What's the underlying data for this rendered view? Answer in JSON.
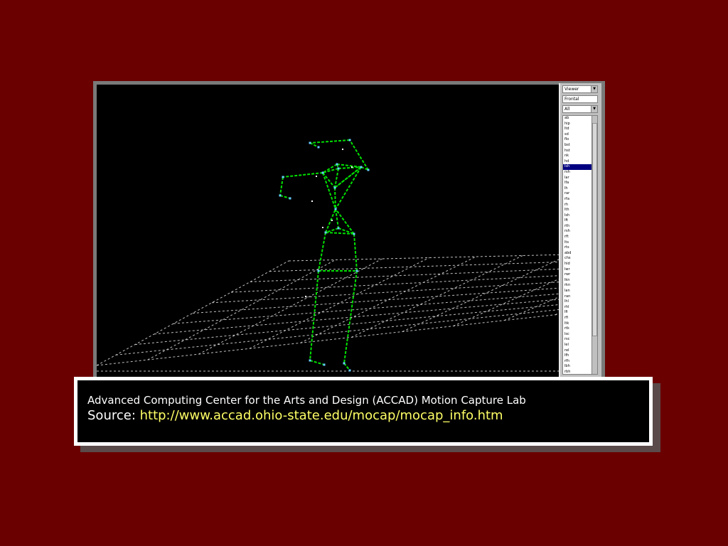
{
  "caption": {
    "title": "Advanced Computing Center for the Arts and Design (ACCAD) Motion Capture Lab",
    "source_label": "Source: ",
    "source_url": "http://www.accad.ohio-state.edu/mocap/mocap_info.htm"
  },
  "colors": {
    "background": "#6b0000",
    "skeleton": "#00e000",
    "grid": "#bfbfbf",
    "url": "#ffff66",
    "list_selection": "#000080"
  },
  "side_panel": {
    "dropdown_1": "Viewer",
    "field_2": "Frontal",
    "dropdown_3": "All",
    "list_items": [
      "ab",
      "hip",
      "ltd",
      "sd",
      "flo",
      "bst",
      "hst",
      "nk",
      "hd",
      "lsh",
      "rsh",
      "lar",
      "lfa",
      "lh",
      "rar",
      "rfa",
      "rh",
      "lth",
      "lsh",
      "lft",
      "rth",
      "rsh",
      "rft",
      "lts",
      "rts",
      "abd",
      "chs",
      "hid",
      "lwr",
      "rwr",
      "lkn",
      "rkn",
      "lan",
      "ran",
      "lhl",
      "rhl",
      "lfi",
      "rfi",
      "ltk",
      "rtk",
      "lsc",
      "rsc",
      "lel",
      "rel",
      "lfh",
      "rfh",
      "lbh",
      "rbh",
      "lsb",
      "rsb",
      "c7",
      "t10",
      "clv",
      "strn",
      "rbk"
    ],
    "selected_index": 9
  },
  "viewport": {
    "label": "3D motion capture viewport"
  }
}
